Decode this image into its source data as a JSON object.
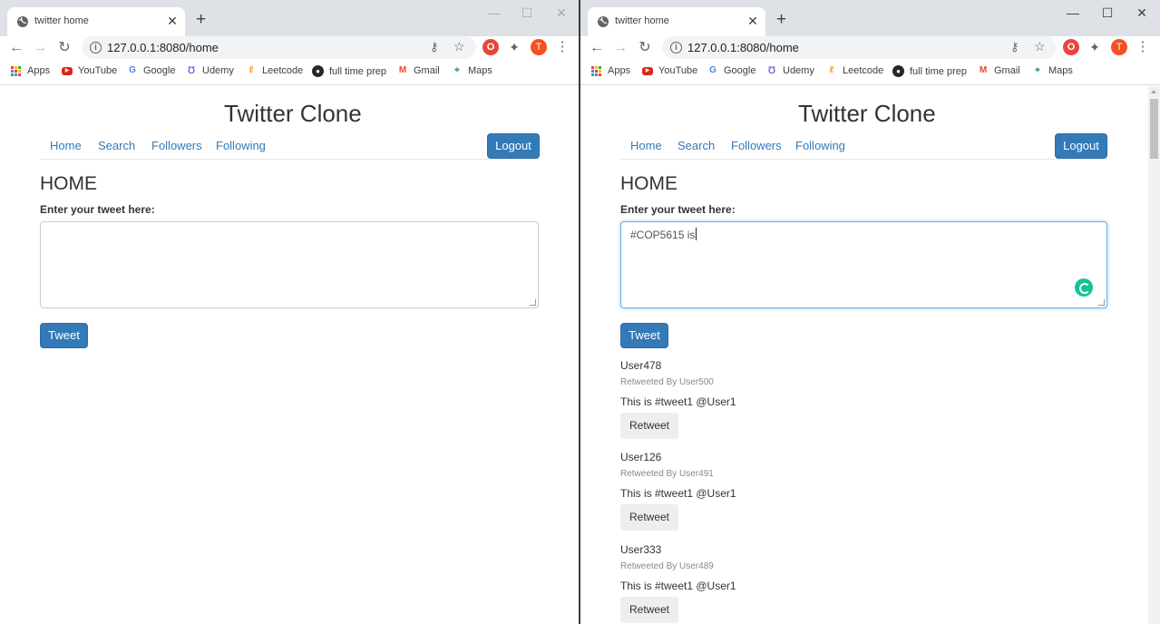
{
  "browser": {
    "tab_title": "twitter home",
    "tab_close": "✕",
    "new_tab": "+",
    "url": "127.0.0.1:8080/home",
    "window_controls": {
      "minimize": "—",
      "maximize": "☐",
      "close": "✕"
    },
    "nav": {
      "back": "←",
      "forward": "→",
      "reload": "↻"
    },
    "avatar_letter": "T",
    "bookmarks": [
      {
        "label": "Apps",
        "icon": "apps-grid-icon"
      },
      {
        "label": "YouTube",
        "icon": "youtube-icon"
      },
      {
        "label": "Google",
        "icon": "google-icon"
      },
      {
        "label": "Udemy",
        "icon": "udemy-icon"
      },
      {
        "label": "Leetcode",
        "icon": "leetcode-icon"
      },
      {
        "label": "full time prep",
        "icon": "github-icon"
      },
      {
        "label": "Gmail",
        "icon": "gmail-icon"
      },
      {
        "label": "Maps",
        "icon": "maps-icon"
      }
    ]
  },
  "site": {
    "title": "Twitter Clone",
    "nav": [
      "Home",
      "Search",
      "Followers",
      "Following"
    ],
    "logout": "Logout",
    "heading": "HOME",
    "tweet_label": "Enter your tweet here:",
    "tweet_button": "Tweet",
    "retweet_button": "Retweet"
  },
  "left_window": {
    "tweet_value": ""
  },
  "right_window": {
    "tweet_value": "#COP5615 is",
    "feed": [
      {
        "user": "User478",
        "retweeted_by": "Retweeted By User500",
        "text": "This is #tweet1 @User1"
      },
      {
        "user": "User126",
        "retweeted_by": "Retweeted By User491",
        "text": "This is #tweet1 @User1"
      },
      {
        "user": "User333",
        "retweeted_by": "Retweeted By User489",
        "text": "This is #tweet1 @User1"
      }
    ]
  },
  "colors": {
    "link": "#337ab7",
    "primary_button": "#337ab7",
    "chrome_tabbar": "#dee1e6",
    "grammarly": "#15c39a"
  }
}
